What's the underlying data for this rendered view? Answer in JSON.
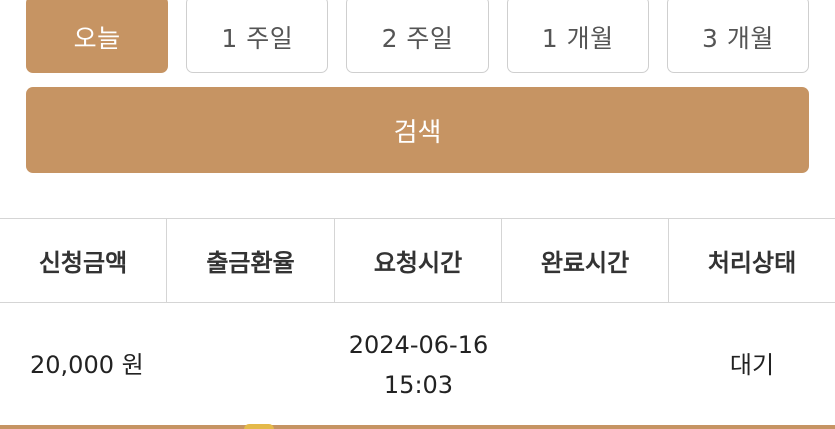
{
  "period": {
    "buttons": [
      "오늘",
      "1 주일",
      "2 주일",
      "1 개월",
      "3 개월"
    ],
    "active_index": 0
  },
  "search": {
    "label": "검색"
  },
  "table": {
    "headers": [
      "신청금액",
      "출금환율",
      "요청시간",
      "완료시간",
      "처리상태"
    ],
    "rows": [
      {
        "amount": "20,000 원",
        "rate": "",
        "request_date": "2024-06-16",
        "request_time": "15:03",
        "complete_time": "",
        "status": "대기"
      }
    ]
  },
  "colors": {
    "accent": "#c69463",
    "border": "#d5d5d5"
  }
}
